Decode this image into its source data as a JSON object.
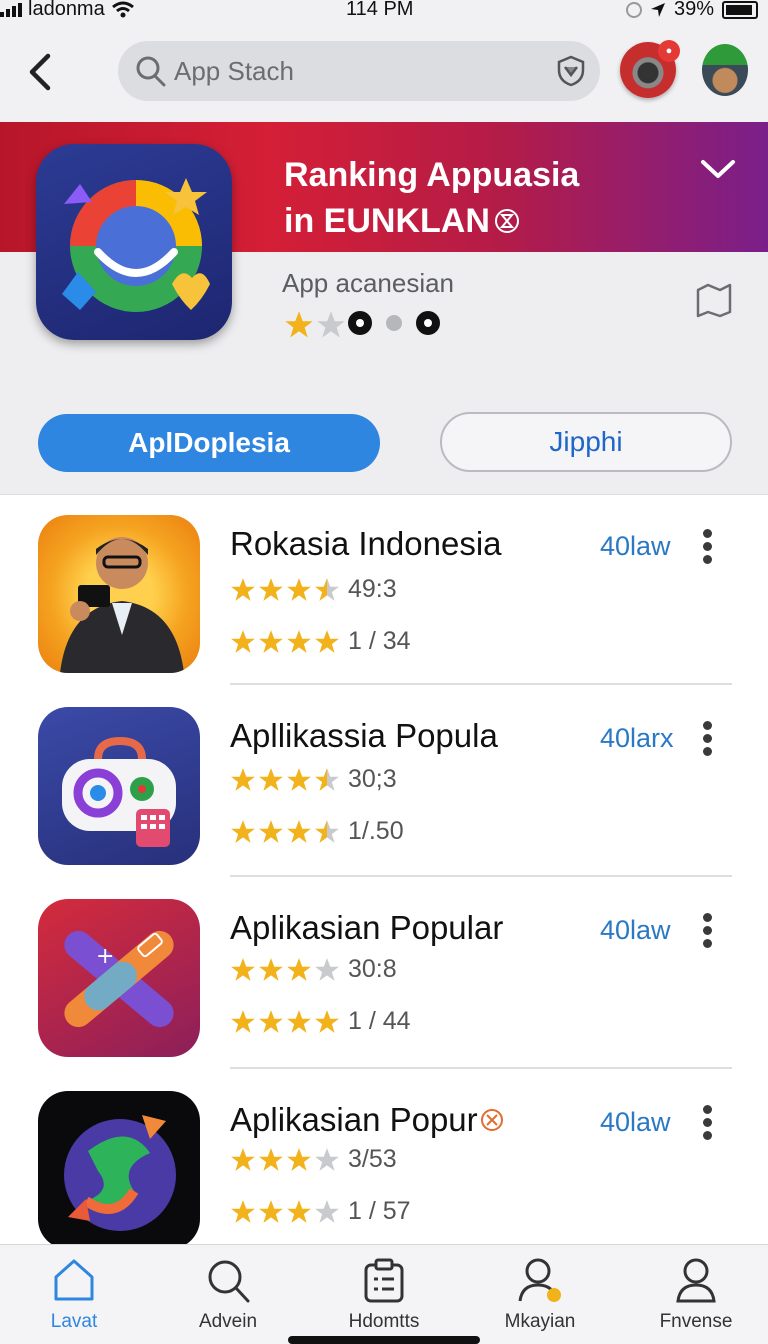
{
  "status_bar": {
    "carrier": "ladonma",
    "time": "114 PM",
    "battery": "39%"
  },
  "header": {
    "search_placeholder": "App Stach"
  },
  "hero": {
    "title_line1": "Ranking Appuasia",
    "title_line2": "in EUNKLAN",
    "subtitle": "App acanesian",
    "rating_stars": 1.5
  },
  "tabs": {
    "primary_label": "AplDoplesia",
    "secondary_label": "Jipphi"
  },
  "apps": [
    {
      "name": "Rokasia Indonesia",
      "size": "40law",
      "rating1_stars": 3.5,
      "rating1_value": "49:3",
      "rating2_stars": 4,
      "rating2_value": "1 / 34",
      "icon": "person-with-phone"
    },
    {
      "name": "Apllikassia Popula",
      "size": "40larx",
      "rating1_stars": 3.5,
      "rating1_value": "30;3",
      "rating2_stars": 3.5,
      "rating2_value": "1/.50",
      "icon": "camera-gamepad"
    },
    {
      "name": "Aplikasian Popular",
      "size": "40law",
      "rating1_stars": 3,
      "rating1_value": "30:8",
      "rating2_stars": 4,
      "rating2_value": "1 / 44",
      "icon": "crossed-tools"
    },
    {
      "name": "Aplikasian Popur",
      "size": "40law",
      "rating1_stars": 3,
      "rating1_value": "3/53",
      "rating2_stars": 3,
      "rating2_value": "1 / 57",
      "icon": "swirl-globe"
    }
  ],
  "bottom_nav": [
    {
      "label": "Lavat",
      "icon": "home-icon",
      "active": true
    },
    {
      "label": "Advein",
      "icon": "search-icon",
      "active": false
    },
    {
      "label": "Hdomtts",
      "icon": "clipboard-icon",
      "active": false
    },
    {
      "label": "Mkayian",
      "icon": "person-badge-icon",
      "active": false
    },
    {
      "label": "Fnvense",
      "icon": "person-icon",
      "active": false
    }
  ],
  "colors": {
    "accent": "#2f86e0",
    "banner_start": "#b7162a",
    "banner_end": "#7a1f8a",
    "star": "#f2b21b",
    "size_text": "#2a78c6"
  }
}
